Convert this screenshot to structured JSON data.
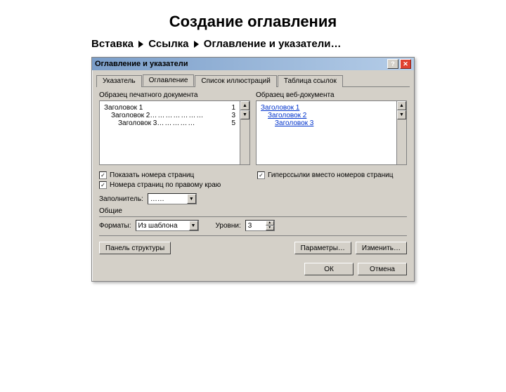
{
  "slide_title": "Создание оглавления",
  "breadcrumb": [
    "Вставка",
    "Ссылка",
    "Оглавление и указатели…"
  ],
  "dialog": {
    "title": "Оглавление и указатели",
    "help": "?",
    "close": "✕",
    "tabs": [
      "Указатель",
      "Оглавление",
      "Список иллюстраций",
      "Таблица ссылок"
    ],
    "active_tab": 1,
    "preview_print_label": "Образец печатного документа",
    "preview_web_label": "Образец веб-документа",
    "toc_print": [
      {
        "text": "Заголовок 1",
        "page": "1",
        "level": 1
      },
      {
        "text": "Заголовок 2",
        "page": "3",
        "level": 2
      },
      {
        "text": "Заголовок 3",
        "page": "5",
        "level": 3
      }
    ],
    "toc_web": [
      {
        "text": "Заголовок 1",
        "level": 1
      },
      {
        "text": "Заголовок 2",
        "level": 2
      },
      {
        "text": "Заголовок 3",
        "level": 3
      }
    ],
    "chk_show_pages": "Показать номера страниц",
    "chk_right_align": "Номера страниц по правому краю",
    "chk_hyperlinks": "Гиперссылки вместо номеров страниц",
    "filler_label": "Заполнитель:",
    "filler_value": "……",
    "general_label": "Общие",
    "format_label": "Форматы:",
    "format_value": "Из шаблона",
    "levels_label": "Уровни:",
    "levels_value": "3",
    "btn_panel": "Панель структуры",
    "btn_params": "Параметры…",
    "btn_modify": "Изменить…",
    "btn_ok": "ОК",
    "btn_cancel": "Отмена"
  }
}
